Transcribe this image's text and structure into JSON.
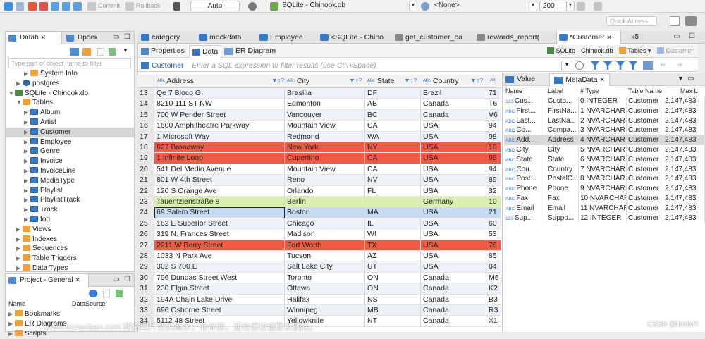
{
  "toolbar": {
    "commit": "Commit",
    "rollback": "Rollback",
    "mode": "Auto",
    "connection": "SQLite - Chinook.db",
    "schema": "<None>",
    "limit": "200"
  },
  "quick_access": "Quick Access",
  "left_panel": {
    "tabs": [
      "Datab",
      "Проек"
    ],
    "search_placeholder": "Type part of object name to filter",
    "tree": [
      {
        "label": "System Info",
        "depth": 2,
        "icon": "fold",
        "tri": "▶"
      },
      {
        "label": "postgres",
        "depth": 1,
        "icon": "pg",
        "tri": "▶"
      },
      {
        "label": "SQLite - Chinook.db",
        "depth": 0,
        "icon": "db",
        "tri": "▼"
      },
      {
        "label": "Tables",
        "depth": 1,
        "icon": "fold",
        "tri": "▼"
      },
      {
        "label": "Album",
        "depth": 2,
        "icon": "tbl",
        "tri": "▶"
      },
      {
        "label": "Artist",
        "depth": 2,
        "icon": "tbl",
        "tri": "▶"
      },
      {
        "label": "Customer",
        "depth": 2,
        "icon": "tbl",
        "tri": "▶",
        "selected": true
      },
      {
        "label": "Employee",
        "depth": 2,
        "icon": "tbl",
        "tri": "▶"
      },
      {
        "label": "Genre",
        "depth": 2,
        "icon": "tbl",
        "tri": "▶"
      },
      {
        "label": "Invoice",
        "depth": 2,
        "icon": "tbl",
        "tri": "▶"
      },
      {
        "label": "InvoiceLine",
        "depth": 2,
        "icon": "tbl",
        "tri": "▶"
      },
      {
        "label": "MediaType",
        "depth": 2,
        "icon": "tbl",
        "tri": "▶"
      },
      {
        "label": "Playlist",
        "depth": 2,
        "icon": "tbl",
        "tri": "▶"
      },
      {
        "label": "PlaylistTrack",
        "depth": 2,
        "icon": "tbl",
        "tri": "▶"
      },
      {
        "label": "Track",
        "depth": 2,
        "icon": "tbl",
        "tri": "▶"
      },
      {
        "label": "foo",
        "depth": 2,
        "icon": "tbl",
        "tri": "▶"
      },
      {
        "label": "Views",
        "depth": 1,
        "icon": "fold",
        "tri": "▶"
      },
      {
        "label": "Indexes",
        "depth": 1,
        "icon": "fold",
        "tri": "▶"
      },
      {
        "label": "Sequences",
        "depth": 1,
        "icon": "fold",
        "tri": "▶"
      },
      {
        "label": "Table Triggers",
        "depth": 1,
        "icon": "fold",
        "tri": "▶"
      },
      {
        "label": "Data Types",
        "depth": 1,
        "icon": "fold",
        "tri": "▶"
      }
    ]
  },
  "project_panel": {
    "tab": "Project - General",
    "col_name": "Name",
    "col_source": "DataSource",
    "items": [
      "Bookmarks",
      "ER Diagrams",
      "Scripts"
    ]
  },
  "editor_tabs": [
    "category",
    "mockdata",
    "Employee",
    "<SQLite - Chino",
    "get_customer_ba",
    "rewards_report(",
    "*Customer"
  ],
  "editor_overflow": "»5",
  "subtabs": [
    "Properties",
    "Data",
    "ER Diagram"
  ],
  "subtab_right": {
    "connection": "SQLite - Chinook.db",
    "tables": "Tables",
    "customer": "Customer"
  },
  "filter": {
    "label": "Customer",
    "placeholder": "Enter a SQL expression to filter results (use Ctrl+Space)"
  },
  "grid": {
    "columns": [
      "Address",
      "City",
      "State",
      "Country"
    ],
    "rows": [
      {
        "n": "13",
        "address": "Qe 7 Bloco G",
        "city": "Brasília",
        "state": "DF",
        "country": "Brazil",
        "extra": "71",
        "style": "odd"
      },
      {
        "n": "14",
        "address": "8210 111 ST NW",
        "city": "Edmonton",
        "state": "AB",
        "country": "Canada",
        "extra": "T6",
        "style": "even"
      },
      {
        "n": "15",
        "address": "700 W Pender Street",
        "city": "Vancouver",
        "state": "BC",
        "country": "Canada",
        "extra": "V6",
        "style": "odd"
      },
      {
        "n": "16",
        "address": "1600 Amphitheatre Parkway",
        "city": "Mountain View",
        "state": "CA",
        "country": "USA",
        "extra": "94",
        "style": "even"
      },
      {
        "n": "17",
        "address": "1 Microsoft Way",
        "city": "Redmond",
        "state": "WA",
        "country": "USA",
        "extra": "98",
        "style": "odd"
      },
      {
        "n": "18",
        "address": "627 Broadway",
        "city": "New York",
        "state": "NY",
        "country": "USA",
        "extra": "10",
        "style": "red"
      },
      {
        "n": "19",
        "address": "1 Infinite Loop",
        "city": "Cupertino",
        "state": "CA",
        "country": "USA",
        "extra": "95",
        "style": "red"
      },
      {
        "n": "20",
        "address": "541 Del Medio Avenue",
        "city": "Mountain View",
        "state": "CA",
        "country": "USA",
        "extra": "94",
        "style": "even"
      },
      {
        "n": "21",
        "address": "801 W 4th Street",
        "city": "Reno",
        "state": "NV",
        "country": "USA",
        "extra": "89",
        "style": "odd"
      },
      {
        "n": "22",
        "address": "120 S Orange Ave",
        "city": "Orlando",
        "state": "FL",
        "country": "USA",
        "extra": "32",
        "style": "even"
      },
      {
        "n": "23",
        "address": "Tauentzienstraße 8",
        "city": "Berlin",
        "state": "",
        "country": "Germany",
        "extra": "10",
        "style": "green"
      },
      {
        "n": "24",
        "address": "69 Salem Street",
        "city": "Boston",
        "state": "MA",
        "country": "USA",
        "extra": "21",
        "style": "sel"
      },
      {
        "n": "25",
        "address": "162 E Superior Street",
        "city": "Chicago",
        "state": "IL",
        "country": "USA",
        "extra": "60",
        "style": "odd"
      },
      {
        "n": "26",
        "address": "319 N. Frances Street",
        "city": "Madison",
        "state": "WI",
        "country": "USA",
        "extra": "53",
        "style": "even"
      },
      {
        "n": "27",
        "address": "2211 W Berry Street",
        "city": "Fort Worth",
        "state": "TX",
        "country": "USA",
        "extra": "76",
        "style": "red"
      },
      {
        "n": "28",
        "address": "1033 N Park Ave",
        "city": "Tucson",
        "state": "AZ",
        "country": "USA",
        "extra": "85",
        "style": "even"
      },
      {
        "n": "29",
        "address": "302 S 700 E",
        "city": "Salt Lake City",
        "state": "UT",
        "country": "USA",
        "extra": "84",
        "style": "odd"
      },
      {
        "n": "30",
        "address": "796 Dundas Street West",
        "city": "Toronto",
        "state": "ON",
        "country": "Canada",
        "extra": "M6",
        "style": "even"
      },
      {
        "n": "31",
        "address": "230 Elgin Street",
        "city": "Ottawa",
        "state": "ON",
        "country": "Canada",
        "extra": "K2",
        "style": "odd"
      },
      {
        "n": "32",
        "address": "194A Chain Lake Drive",
        "city": "Halifax",
        "state": "NS",
        "country": "Canada",
        "extra": "B3",
        "style": "even"
      },
      {
        "n": "33",
        "address": "696 Osborne Street",
        "city": "Winnipeg",
        "state": "MB",
        "country": "Canada",
        "extra": "R3",
        "style": "odd"
      },
      {
        "n": "34",
        "address": "5112 48 Street",
        "city": "Yellowknife",
        "state": "NT",
        "country": "Canada",
        "extra": "X1",
        "style": "even"
      }
    ]
  },
  "meta": {
    "tabs": [
      "Value",
      "MetaData"
    ],
    "columns": [
      "Name",
      "Label",
      "# Type",
      "Table Name",
      "Max L"
    ],
    "rows": [
      {
        "name": "Cus...",
        "label": "Custo...",
        "type": "0 INTEGER",
        "table": "Customer",
        "max": "2,147,483",
        "kind": "123"
      },
      {
        "name": "First...",
        "label": "FirstNa...",
        "type": "1 NVARCHAR",
        "table": "Customer",
        "max": "2,147,483",
        "kind": "ABC"
      },
      {
        "name": "Last...",
        "label": "LastNa...",
        "type": "2 NVARCHAR",
        "table": "Customer",
        "max": "2,147,483",
        "kind": "ABC"
      },
      {
        "name": "Co...",
        "label": "Compa...",
        "type": "3 NVARCHAR",
        "table": "Customer",
        "max": "2,147,483",
        "kind": "ABC"
      },
      {
        "name": "Add...",
        "label": "Address",
        "type": "4 NVARCHAR",
        "table": "Customer",
        "max": "2,147,483",
        "kind": "ABC",
        "selected": true
      },
      {
        "name": "City",
        "label": "City",
        "type": "5 NVARCHAR",
        "table": "Customer",
        "max": "2,147,483",
        "kind": "ABC"
      },
      {
        "name": "State",
        "label": "State",
        "type": "6 NVARCHAR",
        "table": "Customer",
        "max": "2,147,483",
        "kind": "ABC"
      },
      {
        "name": "Cou...",
        "label": "Country",
        "type": "7 NVARCHAR",
        "table": "Customer",
        "max": "2,147,483",
        "kind": "ABC"
      },
      {
        "name": "Post...",
        "label": "PostalC...",
        "type": "8 NVARCHAR",
        "table": "Customer",
        "max": "2,147,483",
        "kind": "ABC"
      },
      {
        "name": "Phone",
        "label": "Phone",
        "type": "9 NVARCHAR",
        "table": "Customer",
        "max": "2,147,483",
        "kind": "ABC"
      },
      {
        "name": "Fax",
        "label": "Fax",
        "type": "10 NVARCHAR",
        "table": "Customer",
        "max": "2,147,483",
        "kind": "ABC"
      },
      {
        "name": "Email",
        "label": "Email",
        "type": "11 NVARCHAR",
        "table": "Customer",
        "max": "2,147,483",
        "kind": "ABC"
      },
      {
        "name": "Sup...",
        "label": "Suppo...",
        "type": "12 INTEGER",
        "table": "Customer",
        "max": "2,147,483",
        "kind": "123"
      }
    ]
  },
  "watermark": "www.toymoban.com 网络图片仅供展示，非存储，如有侵权请联系删除。",
  "credit": "CSDN @linxiMY"
}
